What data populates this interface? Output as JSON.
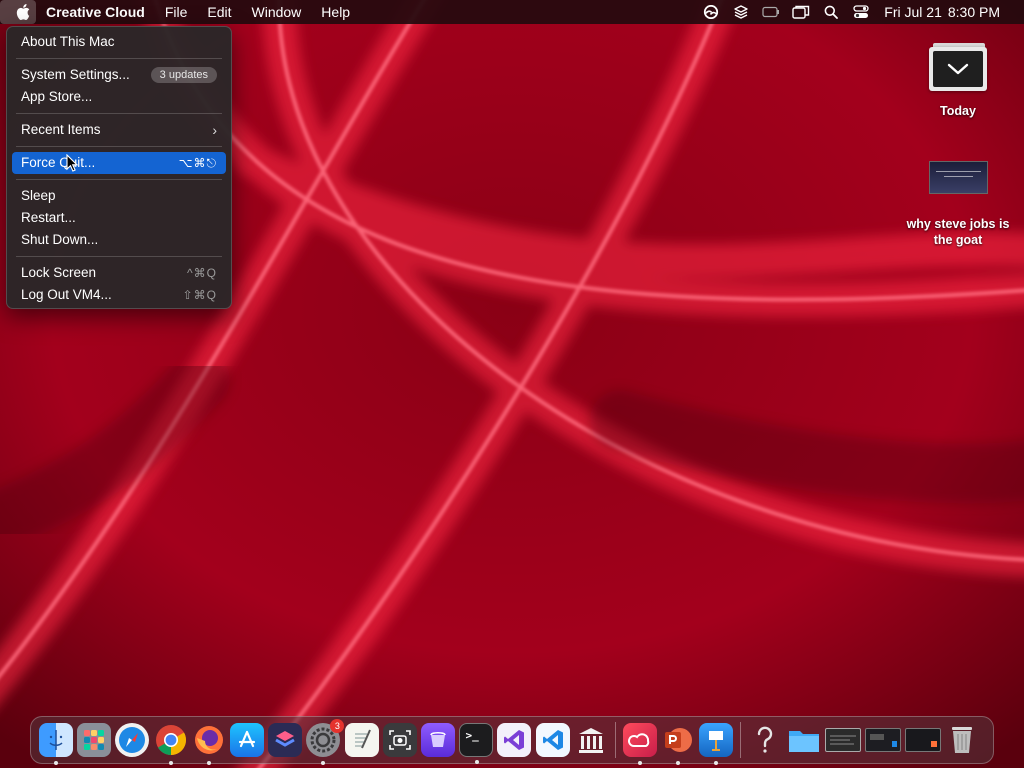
{
  "menubar": {
    "app_name": "Creative Cloud",
    "menus": [
      "File",
      "Edit",
      "Window",
      "Help"
    ],
    "status_icons": [
      "creative-cloud-status-icon",
      "layers-icon",
      "battery-icon",
      "window-switch-icon",
      "spotlight-search-icon",
      "control-center-icon"
    ],
    "clock": {
      "date": "Fri Jul 21",
      "time": "8:30 PM"
    }
  },
  "apple_menu": {
    "about": "About This Mac",
    "system_settings": "System Settings...",
    "updates_badge": "3 updates",
    "app_store": "App Store...",
    "recent_items": "Recent Items",
    "force_quit": "Force Quit...",
    "force_quit_shortcut": "⌥⌘⎋",
    "sleep": "Sleep",
    "restart": "Restart...",
    "shut_down": "Shut Down...",
    "lock_screen": "Lock Screen",
    "lock_shortcut": "^⌘Q",
    "log_out": "Log Out VM4...",
    "log_out_shortcut": "⇧⌘Q"
  },
  "desktop": {
    "today_label": "Today",
    "doc_label_line1": "why steve jobs is",
    "doc_label_line2": "the goat"
  },
  "dock": {
    "icons": [
      "finder-icon",
      "launchpad-icon",
      "safari-icon",
      "chrome-icon",
      "firefox-icon",
      "app-store-icon",
      "shortcuts-icon",
      "system-settings-icon",
      "textedit-icon",
      "screenshot-icon",
      "automator-icon",
      "terminal-icon",
      "visual-studio-icon",
      "vscode-icon",
      "archive-icon",
      "creative-cloud-icon",
      "powerpoint-icon",
      "keynote-icon",
      "help-icon",
      "folder-icon",
      "window-thumbnail-icon",
      "window-thumbnail-icon",
      "window-thumbnail-icon",
      "trash-icon"
    ],
    "settings_badge": "3",
    "terminal_glyph": ">_"
  },
  "colors": {
    "wallpaper": "#b3001e",
    "menu_highlight": "#1464d2",
    "badge_red": "#e5322d"
  }
}
